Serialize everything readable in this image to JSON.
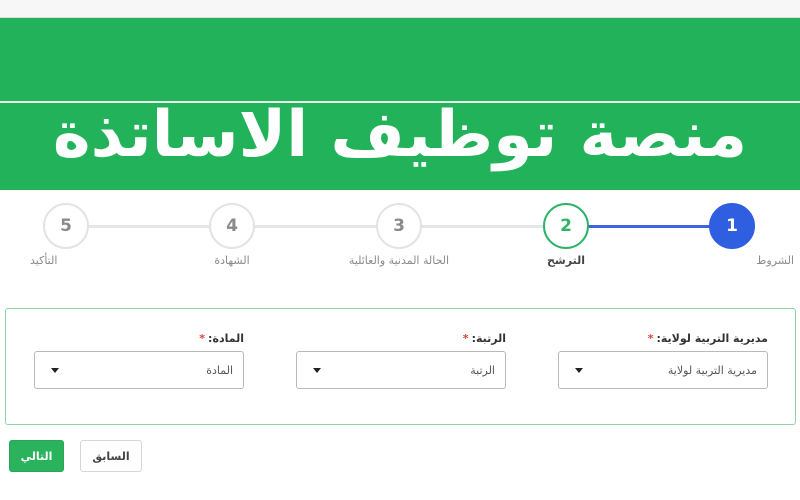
{
  "banner": {
    "title": "منصة توظيف الاساتذة"
  },
  "stepper": {
    "steps": [
      {
        "number": "1",
        "label": "الشروط",
        "state": "done"
      },
      {
        "number": "2",
        "label": "الترشح",
        "state": "current"
      },
      {
        "number": "3",
        "label": "الحالة المدنية والعائلية",
        "state": "pending"
      },
      {
        "number": "4",
        "label": "الشهادة",
        "state": "pending"
      },
      {
        "number": "5",
        "label": "التأكيد",
        "state": "pending"
      }
    ]
  },
  "form": {
    "fields": [
      {
        "label": "مديرية التربية لولاية:",
        "required": "*",
        "value": "مديرية التربية لولاية"
      },
      {
        "label": "الرتبة:",
        "required": "*",
        "value": "الرتبة"
      },
      {
        "label": "المادة:",
        "required": "*",
        "value": "المادة"
      }
    ]
  },
  "buttons": {
    "next": "التالي",
    "prev": "السابق"
  },
  "colors": {
    "brand_green": "#22b35a",
    "step_done_blue": "#2f5fe0",
    "required_red": "#e0413a"
  }
}
